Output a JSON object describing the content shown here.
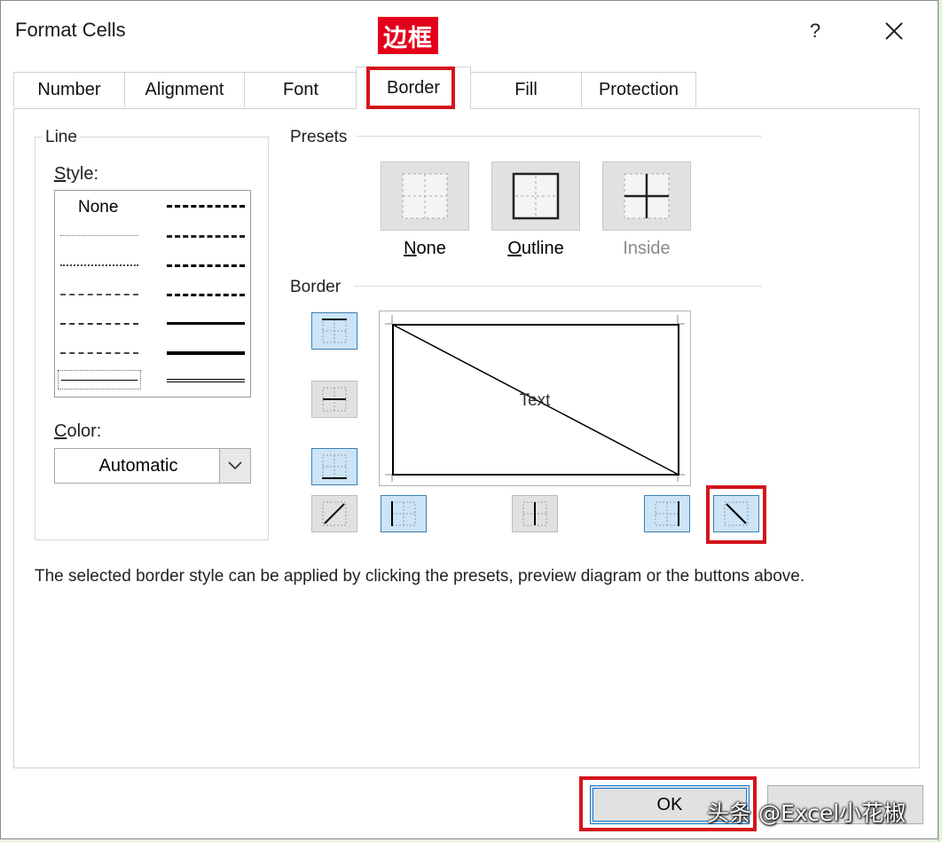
{
  "dialog": {
    "title": "Format Cells",
    "help_label": "?",
    "annotation_label": "边框"
  },
  "tabs": [
    {
      "label": "Number",
      "active": false
    },
    {
      "label": "Alignment",
      "active": false
    },
    {
      "label": "Font",
      "active": false
    },
    {
      "label": "Border",
      "active": true
    },
    {
      "label": "Fill",
      "active": false
    },
    {
      "label": "Protection",
      "active": false
    }
  ],
  "line": {
    "legend": "Line",
    "style_label": "Style:",
    "style_first_option": "None",
    "color_label": "Color:",
    "color_value": "Automatic"
  },
  "presets": {
    "legend": "Presets",
    "items": [
      {
        "label": "None",
        "enabled": true
      },
      {
        "label": "Outline",
        "enabled": true
      },
      {
        "label": "Inside",
        "enabled": false
      }
    ]
  },
  "border": {
    "legend": "Border",
    "preview_text": "Text"
  },
  "hint": "The selected border style can be applied by clicking the presets, preview diagram or the buttons above.",
  "buttons": {
    "ok": "OK"
  },
  "watermark": "头条 @Excel小花椒",
  "colors": {
    "highlight": "#d4141c",
    "selected_fill": "#cce4f7",
    "selected_border": "#3c7fb1",
    "focus_blue": "#0f78d7"
  }
}
